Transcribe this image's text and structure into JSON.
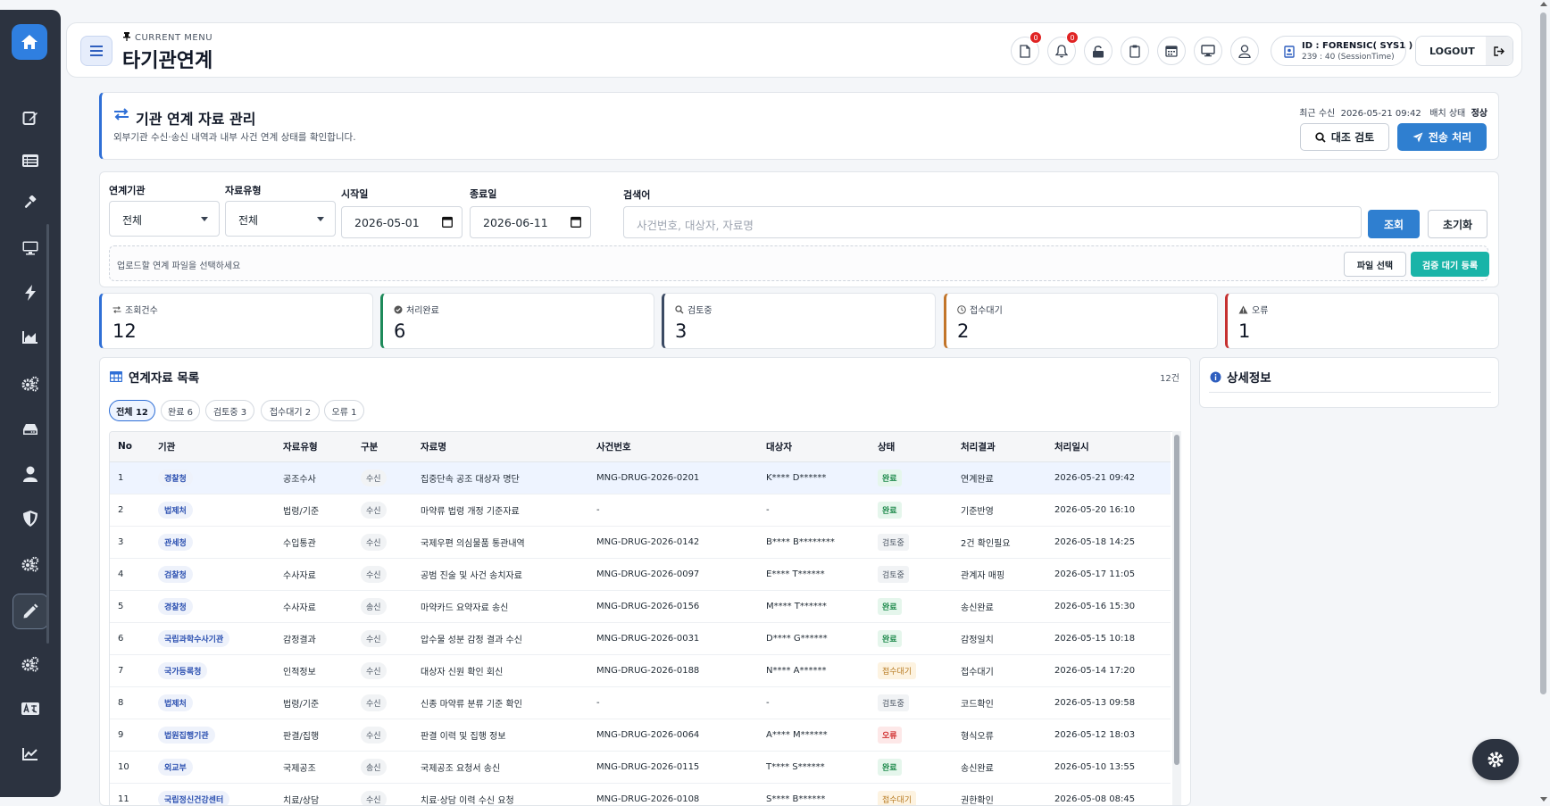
{
  "header": {
    "current_menu_label": "CURRENT MENU",
    "page_title": "타기관연계",
    "doc_badge": "0",
    "bell_badge": "0",
    "user_id": "ID : FORENSIC( SYS1 )",
    "session_time": "239 : 40 (SessionTime)",
    "logout_label": "LOGOUT"
  },
  "title_card": {
    "title": "기관 연계 자료 관리",
    "description": "외부기관 수신·송신 내역과 내부 사건 연계 상태를 확인합니다.",
    "recent_label": "최근 수신",
    "recent_value": "2026-05-21 09:42",
    "batch_label": "배치 상태",
    "batch_value": "정상",
    "compare_button": "대조 검토",
    "send_button": "전송 처리"
  },
  "filters": {
    "agency_label": "연계기관",
    "agency_value": "전체",
    "type_label": "자료유형",
    "type_value": "전체",
    "start_label": "시작일",
    "start_value": "2026-05-01",
    "end_label": "종료일",
    "end_value": "2026-06-11",
    "search_label": "검색어",
    "search_placeholder": "사건번호, 대상자, 자료명",
    "query_button": "조회",
    "reset_button": "초기화",
    "upload_text": "업로드할 연계 파일을 선택하세요",
    "file_button": "파일 선택",
    "register_button": "검증 대기 등록"
  },
  "stats": [
    {
      "label": "조회건수",
      "value": "12",
      "color": "#2f6fd6"
    },
    {
      "label": "처리완료",
      "value": "6",
      "color": "#1e8a5a"
    },
    {
      "label": "검토중",
      "value": "3",
      "color": "#3b4a63"
    },
    {
      "label": "접수대기",
      "value": "2",
      "color": "#c2752a"
    },
    {
      "label": "오류",
      "value": "1",
      "color": "#c53030"
    }
  ],
  "list": {
    "title": "연계자료 목록",
    "count": "12건",
    "chips": [
      "전체 12",
      "완료 6",
      "검토중 3",
      "접수대기 2",
      "오류 1"
    ],
    "columns": [
      "No",
      "기관",
      "자료유형",
      "구분",
      "자료명",
      "사건번호",
      "대상자",
      "상태",
      "처리결과",
      "처리일시"
    ],
    "rows": [
      [
        "1",
        "경찰청",
        "공조수사",
        "수신",
        "집중단속 공조 대상자 명단",
        "MNG-DRUG-2026-0201",
        "K**** D******",
        "완료",
        "연계완료",
        "2026-05-21 09:42"
      ],
      [
        "2",
        "법제처",
        "법령/기준",
        "수신",
        "마약류 법령 개정 기준자료",
        "-",
        "-",
        "완료",
        "기준반영",
        "2026-05-20 16:10"
      ],
      [
        "3",
        "관세청",
        "수입통관",
        "수신",
        "국제우편 의심물품 통관내역",
        "MNG-DRUG-2026-0142",
        "B**** B********",
        "검토중",
        "2건 확인필요",
        "2026-05-18 14:25"
      ],
      [
        "4",
        "검찰청",
        "수사자료",
        "수신",
        "공범 진술 및 사건 송치자료",
        "MNG-DRUG-2026-0097",
        "E**** T******",
        "검토중",
        "관계자 매핑",
        "2026-05-17 11:05"
      ],
      [
        "5",
        "경찰청",
        "수사자료",
        "송신",
        "마약카드 요약자료 송신",
        "MNG-DRUG-2026-0156",
        "M**** T******",
        "완료",
        "송신완료",
        "2026-05-16 15:30"
      ],
      [
        "6",
        "국립과학수사기관",
        "감정결과",
        "수신",
        "압수물 성분 감정 결과 수신",
        "MNG-DRUG-2026-0031",
        "D**** G******",
        "완료",
        "감정일치",
        "2026-05-15 10:18"
      ],
      [
        "7",
        "국가등록청",
        "인적정보",
        "수신",
        "대상자 신원 확인 회신",
        "MNG-DRUG-2026-0188",
        "N**** A******",
        "접수대기",
        "접수대기",
        "2026-05-14 17:20"
      ],
      [
        "8",
        "법제처",
        "법령/기준",
        "수신",
        "신종 마약류 분류 기준 확인",
        "-",
        "-",
        "검토중",
        "코드확인",
        "2026-05-13 09:58"
      ],
      [
        "9",
        "법원집행기관",
        "판결/집행",
        "수신",
        "판결 이력 및 집행 정보",
        "MNG-DRUG-2026-0064",
        "A**** M******",
        "오류",
        "형식오류",
        "2026-05-12 18:03"
      ],
      [
        "10",
        "외교부",
        "국제공조",
        "송신",
        "국제공조 요청서 송신",
        "MNG-DRUG-2026-0115",
        "T**** S******",
        "완료",
        "송신완료",
        "2026-05-10 13:55"
      ],
      [
        "11",
        "국립정신건강센터",
        "치료/상담",
        "수신",
        "치료·상담 이력 수신 요청",
        "MNG-DRUG-2026-0108",
        "S**** B******",
        "접수대기",
        "권한확인",
        "2026-05-08 08:45"
      ]
    ]
  },
  "detail": {
    "title": "상세정보"
  },
  "icons": {
    "sidebar": [
      "home-icon",
      "edit-icon",
      "list-icon",
      "gavel-icon",
      "monitor-icon",
      "bolt-icon",
      "chart-area-icon",
      "cogs-icon",
      "drive-icon",
      "user-icon",
      "shield-icon",
      "cogs-icon",
      "pen-icon",
      "cogs-icon",
      "language-icon",
      "chart-line-icon"
    ]
  },
  "colors": {
    "primary": "#2f7fd0",
    "teal": "#19b4a8",
    "sidebar": "#2c3340"
  }
}
